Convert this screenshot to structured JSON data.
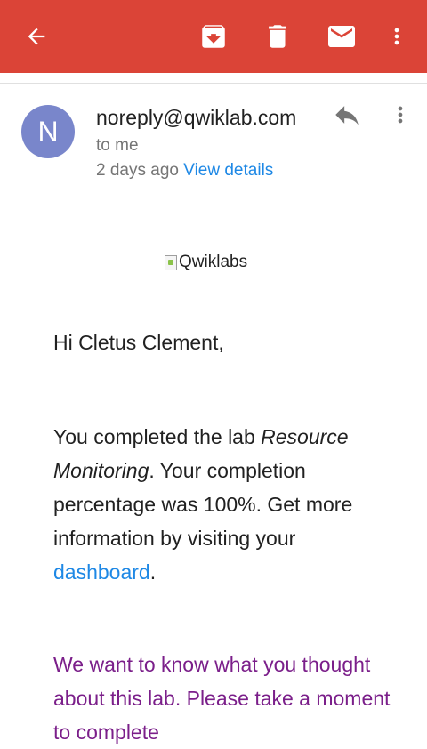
{
  "toolbar": {
    "back_icon": "arrow-back-icon",
    "archive_icon": "archive-icon",
    "delete_icon": "delete-icon",
    "mark_unread_icon": "mail-icon",
    "more_icon": "more-vert-icon",
    "color": "#db4437"
  },
  "message": {
    "avatar_letter": "N",
    "avatar_color": "#7986cb",
    "sender": "noreply@qwiklab.com",
    "recipient": "to me",
    "time": "2 days ago",
    "view_details": "View details"
  },
  "content": {
    "logo_alt": "Qwiklabs",
    "greeting": "Hi Cletus Clement,",
    "body_prefix": "You completed the lab ",
    "lab_name": "Resource Monitoring",
    "body_middle": ". Your completion percentage was 100%. Get more information by visiting your ",
    "dashboard_link": "dashboard",
    "body_suffix": ".",
    "survey_text": "We want to know what you thought about this lab. Please take a moment to complete"
  }
}
